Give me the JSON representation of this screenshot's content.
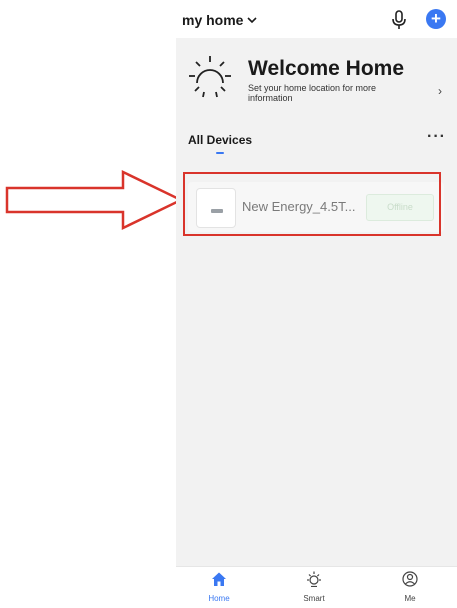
{
  "header": {
    "home_label": "my home"
  },
  "welcome": {
    "title": "Welcome Home",
    "subtitle": "Set your home location for more information"
  },
  "devices": {
    "section_label": "All Devices",
    "more_label": "···",
    "items": [
      {
        "name": "New Energy_4.5T...",
        "status": "Offline"
      }
    ]
  },
  "nav": {
    "home": "Home",
    "smart": "Smart",
    "me": "Me"
  },
  "colors": {
    "accent": "#3a78f2",
    "annotation": "#d9342b"
  },
  "icons": {
    "home_dropdown": "chevron-down-icon",
    "voice": "microphone-icon",
    "add": "plus-icon",
    "weather": "sun-icon",
    "welcome_arrow": "chevron-right-icon",
    "nav_home": "house-icon",
    "nav_smart": "sun-icon",
    "nav_me": "user-circle-icon"
  }
}
